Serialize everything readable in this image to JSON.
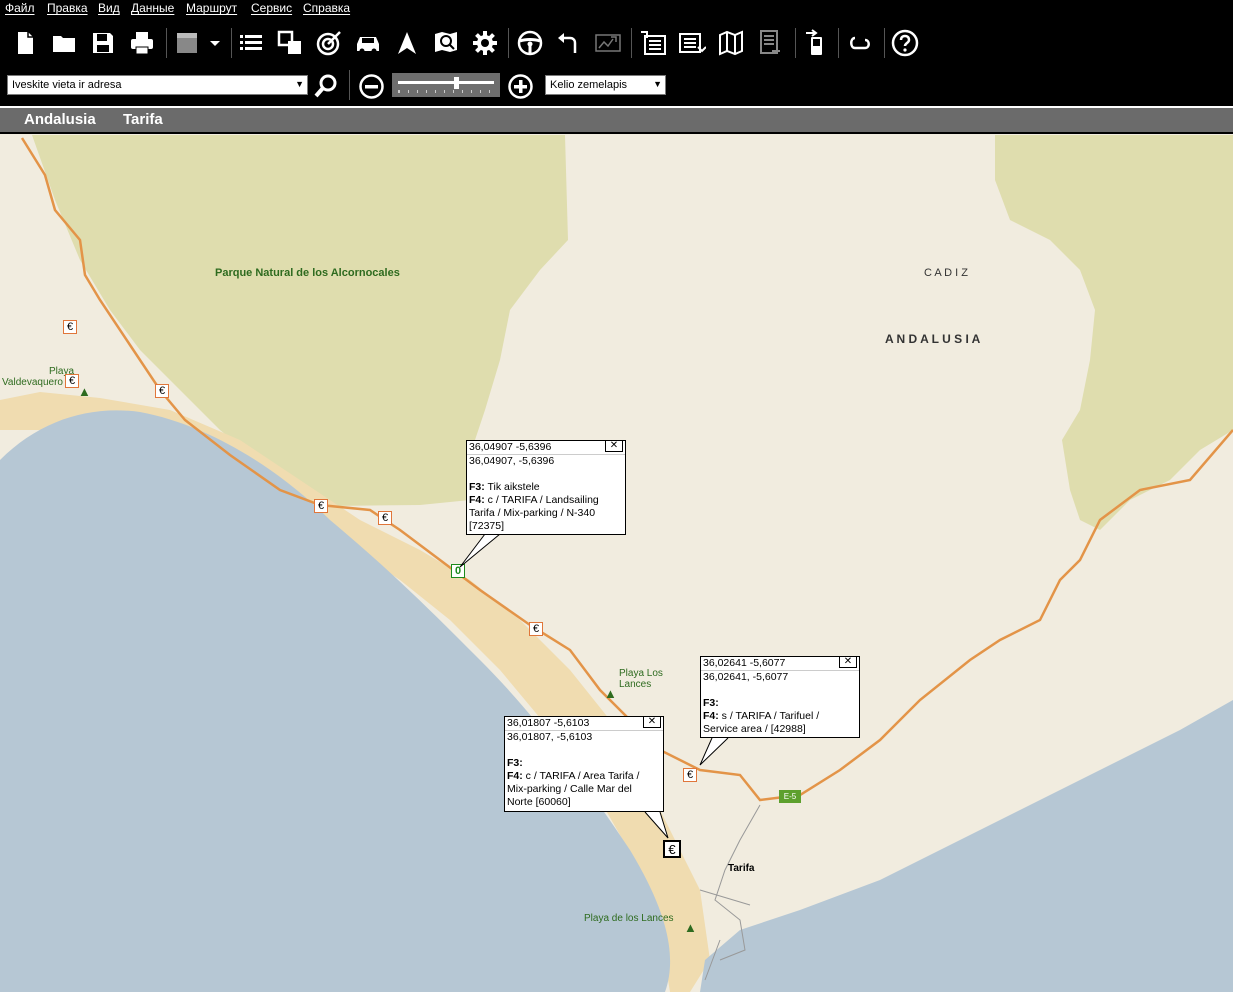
{
  "menu": [
    "Файл",
    "Правка",
    "Вид",
    "Данные",
    "Маршрут",
    "Сервис",
    "Справка"
  ],
  "toolbar_icons": [
    "new-document-icon",
    "open-folder-icon",
    "save-icon",
    "print-icon",
    "layer-select-icon",
    "dropdown-arrow-icon",
    "list-icon",
    "copy-windows-icon",
    "target-icon",
    "car-icon",
    "navigation-arrow-icon",
    "map-search-icon",
    "settings-gear-icon",
    "steering-wheel-icon",
    "undo-icon",
    "image-export-icon",
    "import-icon",
    "export-icon",
    "map-book-icon",
    "report-icon",
    "phone-transfer-icon",
    "connect-icon",
    "help-icon"
  ],
  "search": {
    "placeholder": "Iveskite vieta ir adresa",
    "value": "Iveskite vieta ir adresa"
  },
  "zoom": {
    "level": 0.6
  },
  "map_type": {
    "selected": "Kelio zemelapis"
  },
  "breadcrumb": [
    "Andalusia",
    "Tarifa"
  ],
  "map": {
    "labels": {
      "park": "Parque Natural de los Alcornocales",
      "cadiz": "C A D I Z",
      "andalusia": "A N D A L U S I A",
      "playa_valdevaquero": "Playa Valdevaquero",
      "playa_valdevaquero_1": "Playa",
      "playa_valdevaquero_2": "Valdevaquero",
      "playa_los_lances_1": "Playa Los",
      "playa_los_lances_2": "Lances",
      "tarifa": "Tarifa",
      "playa_de_los_lances": "Playa de los Lances",
      "road_e5": "E-5",
      "marker_zero": "0",
      "euro": "€"
    },
    "colors": {
      "land": "#f1ecdf",
      "sea": "#b6c7d4",
      "park": "#dfddae",
      "beach": "#f0dcb0",
      "road": "#e39448",
      "label_green": "#2e6b1f"
    },
    "popups": [
      {
        "title": "36,04907 -5,6396",
        "coords": "36,04907, -5,6396",
        "f3_key": "F3:",
        "f3": "Tik aikstele",
        "f4_key": "F4:",
        "f4_lines": [
          "c / TARIFA / Landsailing",
          "Tarifa / Mix-parking / N-340",
          "[72375]"
        ]
      },
      {
        "title": "36,02641 -5,6077",
        "coords": "36,02641, -5,6077",
        "f3_key": "F3:",
        "f3": "",
        "f4_key": "F4:",
        "f4_lines": [
          "s / TARIFA / Tarifuel /",
          "Service area /  [42988]"
        ]
      },
      {
        "title": "36,01807 -5,6103",
        "coords": "36,01807, -5,6103",
        "f3_key": "F3:",
        "f3": "",
        "f4_key": "F4:",
        "f4_lines": [
          "c / TARIFA / Area Tarifa /",
          "Mix-parking / Calle Mar del",
          "Norte [60060]"
        ]
      }
    ]
  }
}
